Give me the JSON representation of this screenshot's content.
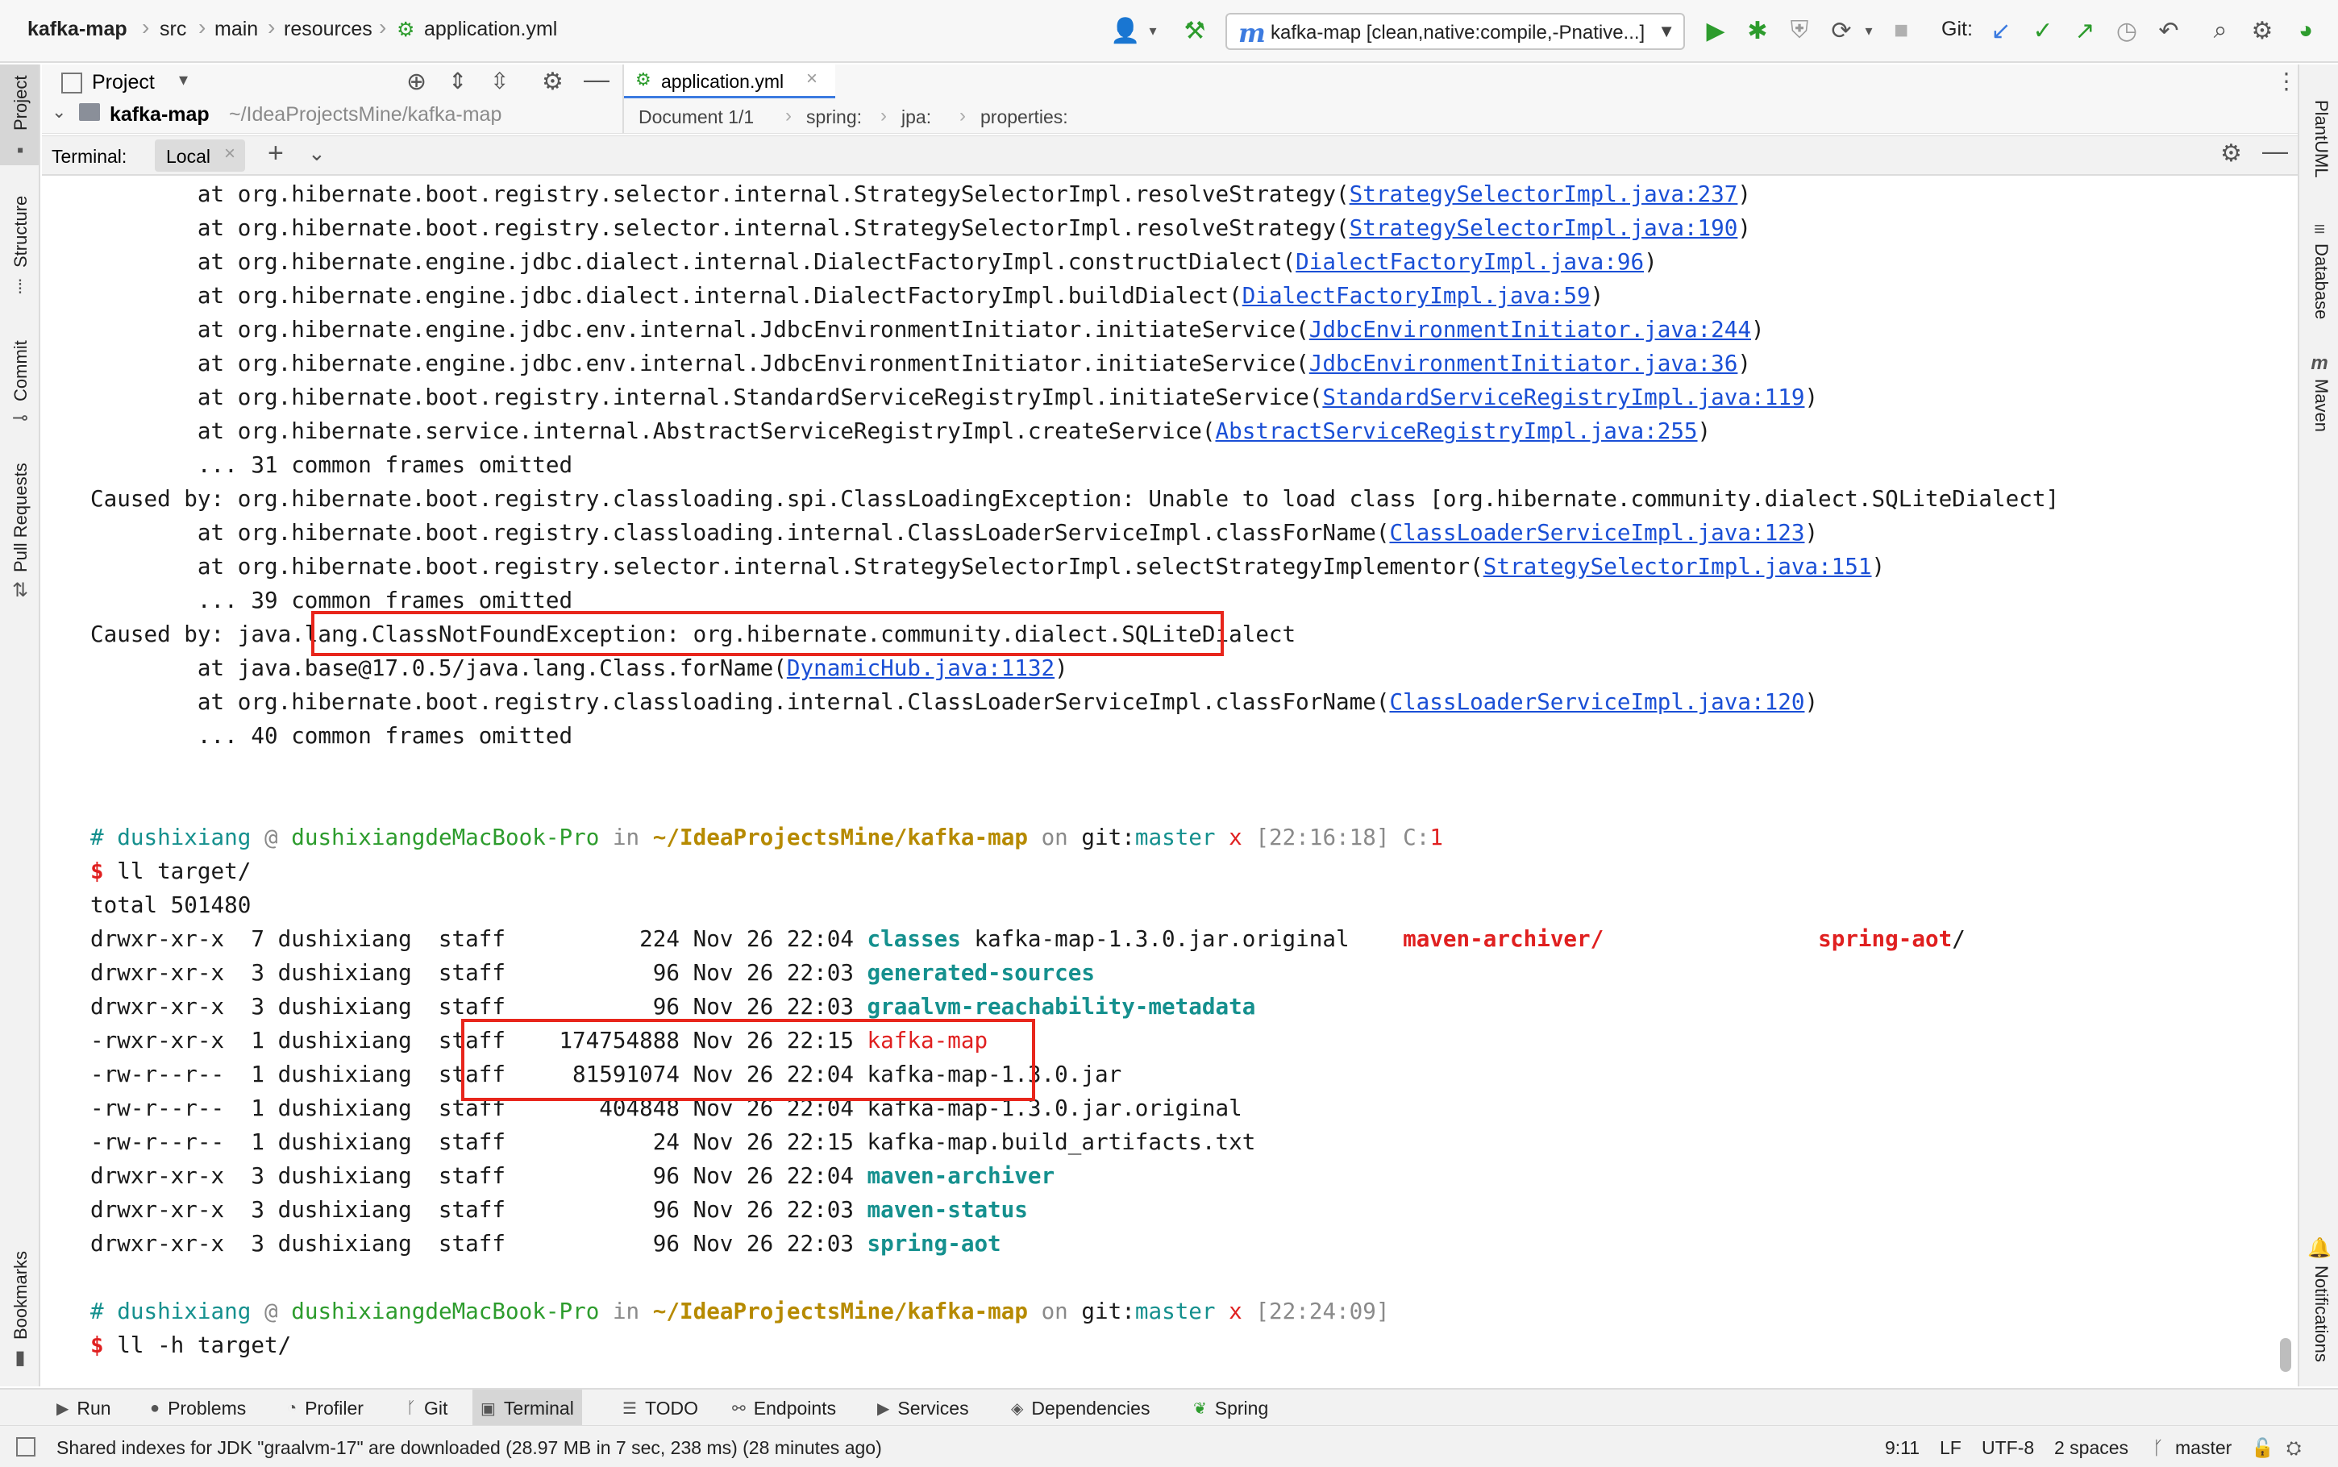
{
  "breadcrumb": {
    "project": "kafka-map",
    "parts": [
      "src",
      "main",
      "resources"
    ],
    "file": "application.yml"
  },
  "run_config": {
    "label": "kafka-map [clean,native:compile,-Pnative...]"
  },
  "git_label": "Git:",
  "left_tools": [
    "Project",
    "Structure",
    "Commit",
    "Pull Requests",
    "Bookmarks"
  ],
  "right_tools": [
    "PlantUML",
    "Database",
    "Maven",
    "Notifications"
  ],
  "project_panel": {
    "title": "Project",
    "root_name": "kafka-map",
    "root_path": "~/IdeaProjectsMine/kafka-map"
  },
  "editor": {
    "tab": "application.yml",
    "path": [
      "Document 1/1",
      "spring:",
      "jpa:",
      "properties:"
    ]
  },
  "terminal": {
    "title": "Terminal:",
    "tab": "Local",
    "stack1": [
      {
        "pre": "        at org.hibernate.boot.registry.selector.internal.StrategySelectorImpl.resolveStrategy(",
        "link": "StrategySelectorImpl.java:237",
        "post": ")"
      },
      {
        "pre": "        at org.hibernate.boot.registry.selector.internal.StrategySelectorImpl.resolveStrategy(",
        "link": "StrategySelectorImpl.java:190",
        "post": ")"
      },
      {
        "pre": "        at org.hibernate.engine.jdbc.dialect.internal.DialectFactoryImpl.constructDialect(",
        "link": "DialectFactoryImpl.java:96",
        "post": ")"
      },
      {
        "pre": "        at org.hibernate.engine.jdbc.dialect.internal.DialectFactoryImpl.buildDialect(",
        "link": "DialectFactoryImpl.java:59",
        "post": ")"
      },
      {
        "pre": "        at org.hibernate.engine.jdbc.env.internal.JdbcEnvironmentInitiator.initiateService(",
        "link": "JdbcEnvironmentInitiator.java:244",
        "post": ")"
      },
      {
        "pre": "        at org.hibernate.engine.jdbc.env.internal.JdbcEnvironmentInitiator.initiateService(",
        "link": "JdbcEnvironmentInitiator.java:36",
        "post": ")"
      },
      {
        "pre": "        at org.hibernate.boot.registry.internal.StandardServiceRegistryImpl.initiateService(",
        "link": "StandardServiceRegistryImpl.java:119",
        "post": ")"
      },
      {
        "pre": "        at org.hibernate.service.internal.AbstractServiceRegistryImpl.createService(",
        "link": "AbstractServiceRegistryImpl.java:255",
        "post": ")"
      },
      {
        "pre": "        ... 31 common frames omitted",
        "link": "",
        "post": ""
      },
      {
        "pre": "Caused by: org.hibernate.boot.registry.classloading.spi.ClassLoadingException: Unable to load class [org.hibernate.community.dialect.SQLiteDialect]",
        "link": "",
        "post": ""
      },
      {
        "pre": "        at org.hibernate.boot.registry.classloading.internal.ClassLoaderServiceImpl.classForName(",
        "link": "ClassLoaderServiceImpl.java:123",
        "post": ")"
      },
      {
        "pre": "        at org.hibernate.boot.registry.selector.internal.StrategySelectorImpl.selectStrategyImplementor(",
        "link": "StrategySelectorImpl.java:151",
        "post": ")"
      },
      {
        "pre": "        ... 39 common frames omitted",
        "link": "",
        "post": ""
      },
      {
        "pre": "Caused by: java.lang.ClassNotFoundException: org.hibernate.community.dialect.SQLiteDialect",
        "link": "",
        "post": ""
      },
      {
        "pre": "        at java.base@17.0.5/java.lang.Class.forName(",
        "link": "DynamicHub.java:1132",
        "post": ")"
      },
      {
        "pre": "        at org.hibernate.boot.registry.classloading.internal.ClassLoaderServiceImpl.classForName(",
        "link": "ClassLoaderServiceImpl.java:120",
        "post": ")"
      },
      {
        "pre": "        ... 40 common frames omitted",
        "link": "",
        "post": ""
      }
    ],
    "prompt1": {
      "user": "dushixiang",
      "at": "@",
      "host": "dushixiangdeMacBook-Pro",
      "in": "in",
      "path": "~/IdeaProjectsMine/kafka-map",
      "on": "on",
      "git": "git:",
      "branch": "master",
      "dirty": "x",
      "time": "[22:16:18]",
      "code_label": "C:",
      "code": "1"
    },
    "cmd1": "ll target/",
    "total": "total 501480",
    "listing": [
      {
        "perm": "drwxr-xr-x",
        "n": "7",
        "user": "dushixiang",
        "group": "staff",
        "size": "224",
        "date": "Nov 26 22:04",
        "name": "classes",
        "kind": "dir",
        "extra": [
          "kafka-map-1.3.0.jar.original",
          "maven-archiver/",
          "spring-aot/"
        ]
      },
      {
        "perm": "drwxr-xr-x",
        "n": "3",
        "user": "dushixiang",
        "group": "staff",
        "size": "96",
        "date": "Nov 26 22:03",
        "name": "generated-sources",
        "kind": "dir"
      },
      {
        "perm": "drwxr-xr-x",
        "n": "3",
        "user": "dushixiang",
        "group": "staff",
        "size": "96",
        "date": "Nov 26 22:03",
        "name": "graalvm-reachability-metadata",
        "kind": "dir"
      },
      {
        "perm": "-rwxr-xr-x",
        "n": "1",
        "user": "dushixiang",
        "group": "staff",
        "size": "174754888",
        "date": "Nov 26 22:15",
        "name": "kafka-map",
        "kind": "exec"
      },
      {
        "perm": "-rw-r--r--",
        "n": "1",
        "user": "dushixiang",
        "group": "staff",
        "size": "81591074",
        "date": "Nov 26 22:04",
        "name": "kafka-map-1.3.0.jar",
        "kind": "file"
      },
      {
        "perm": "-rw-r--r--",
        "n": "1",
        "user": "dushixiang",
        "group": "staff",
        "size": "404848",
        "date": "Nov 26 22:04",
        "name": "kafka-map-1.3.0.jar.original",
        "kind": "file"
      },
      {
        "perm": "-rw-r--r--",
        "n": "1",
        "user": "dushixiang",
        "group": "staff",
        "size": "24",
        "date": "Nov 26 22:15",
        "name": "kafka-map.build_artifacts.txt",
        "kind": "file"
      },
      {
        "perm": "drwxr-xr-x",
        "n": "3",
        "user": "dushixiang",
        "group": "staff",
        "size": "96",
        "date": "Nov 26 22:04",
        "name": "maven-archiver",
        "kind": "dir"
      },
      {
        "perm": "drwxr-xr-x",
        "n": "3",
        "user": "dushixiang",
        "group": "staff",
        "size": "96",
        "date": "Nov 26 22:03",
        "name": "maven-status",
        "kind": "dir"
      },
      {
        "perm": "drwxr-xr-x",
        "n": "3",
        "user": "dushixiang",
        "group": "staff",
        "size": "96",
        "date": "Nov 26 22:03",
        "name": "spring-aot",
        "kind": "dir"
      }
    ],
    "prompt2": {
      "user": "dushixiang",
      "at": "@",
      "host": "dushixiangdeMacBook-Pro",
      "in": "in",
      "path": "~/IdeaProjectsMine/kafka-map",
      "on": "on",
      "git": "git:",
      "branch": "master",
      "dirty": "x",
      "time": "[22:24:09]"
    },
    "cmd2": "ll -h target/"
  },
  "tool_tabs": [
    "Run",
    "Problems",
    "Profiler",
    "Git",
    "Terminal",
    "TODO",
    "Endpoints",
    "Services",
    "Dependencies",
    "Spring"
  ],
  "active_tool_tab": "Terminal",
  "status": {
    "message": "Shared indexes for JDK \"graalvm-17\" are downloaded (28.97 MB in 7 sec, 238 ms) (28 minutes ago)",
    "position": "9:11",
    "line_sep": "LF",
    "encoding": "UTF-8",
    "indent": "2 spaces",
    "branch": "master"
  },
  "colors": {
    "link": "#1a4fd6",
    "highlight_box": "#e8261c",
    "dir_teal": "#15908e",
    "prompt_gold": "#b68a00",
    "exec_red": "#e02020",
    "run_green": "#2d9c2d"
  }
}
